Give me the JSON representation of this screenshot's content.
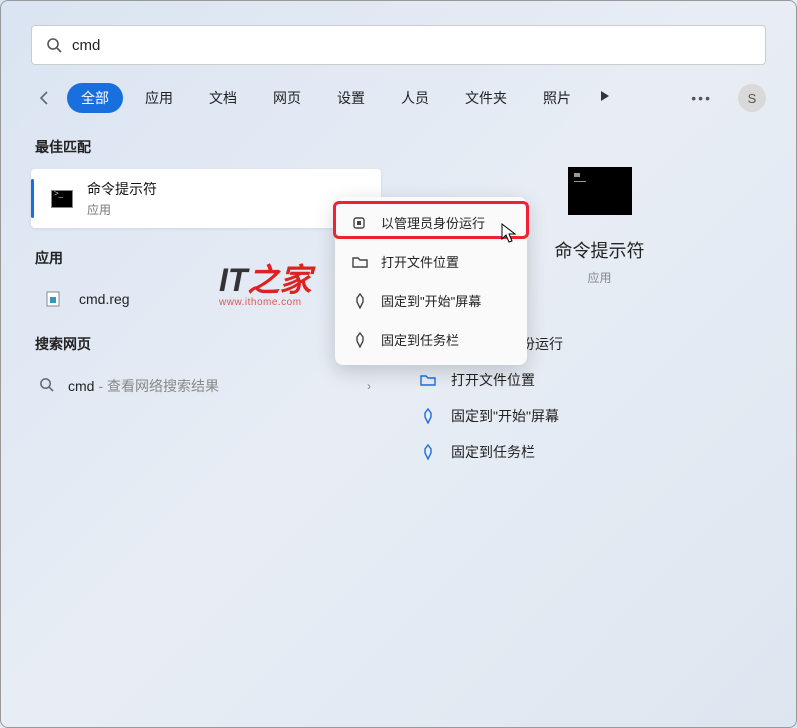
{
  "search": {
    "query": "cmd"
  },
  "tabs": [
    "全部",
    "应用",
    "文档",
    "网页",
    "设置",
    "人员",
    "文件夹",
    "照片"
  ],
  "avatar_letter": "S",
  "sections": {
    "best_match": "最佳匹配",
    "apps": "应用",
    "web": "搜索网页"
  },
  "best_match": {
    "title": "命令提示符",
    "subtitle": "应用"
  },
  "app_result": {
    "name": "cmd.reg"
  },
  "web_result": {
    "query": "cmd",
    "hint": " - 查看网络搜索结果"
  },
  "context_menu": {
    "run_admin": "以管理员身份运行",
    "open_location": "打开文件位置",
    "pin_start": "固定到\"开始\"屏幕",
    "pin_taskbar": "固定到任务栏"
  },
  "preview": {
    "title": "命令提示符",
    "subtitle": "应用"
  },
  "preview_actions": {
    "run_admin": "以管理员身份运行",
    "open_location": "打开文件位置",
    "pin_start": "固定到\"开始\"屏幕",
    "pin_taskbar": "固定到任务栏"
  },
  "watermark": {
    "url": "www.ithome.com"
  }
}
